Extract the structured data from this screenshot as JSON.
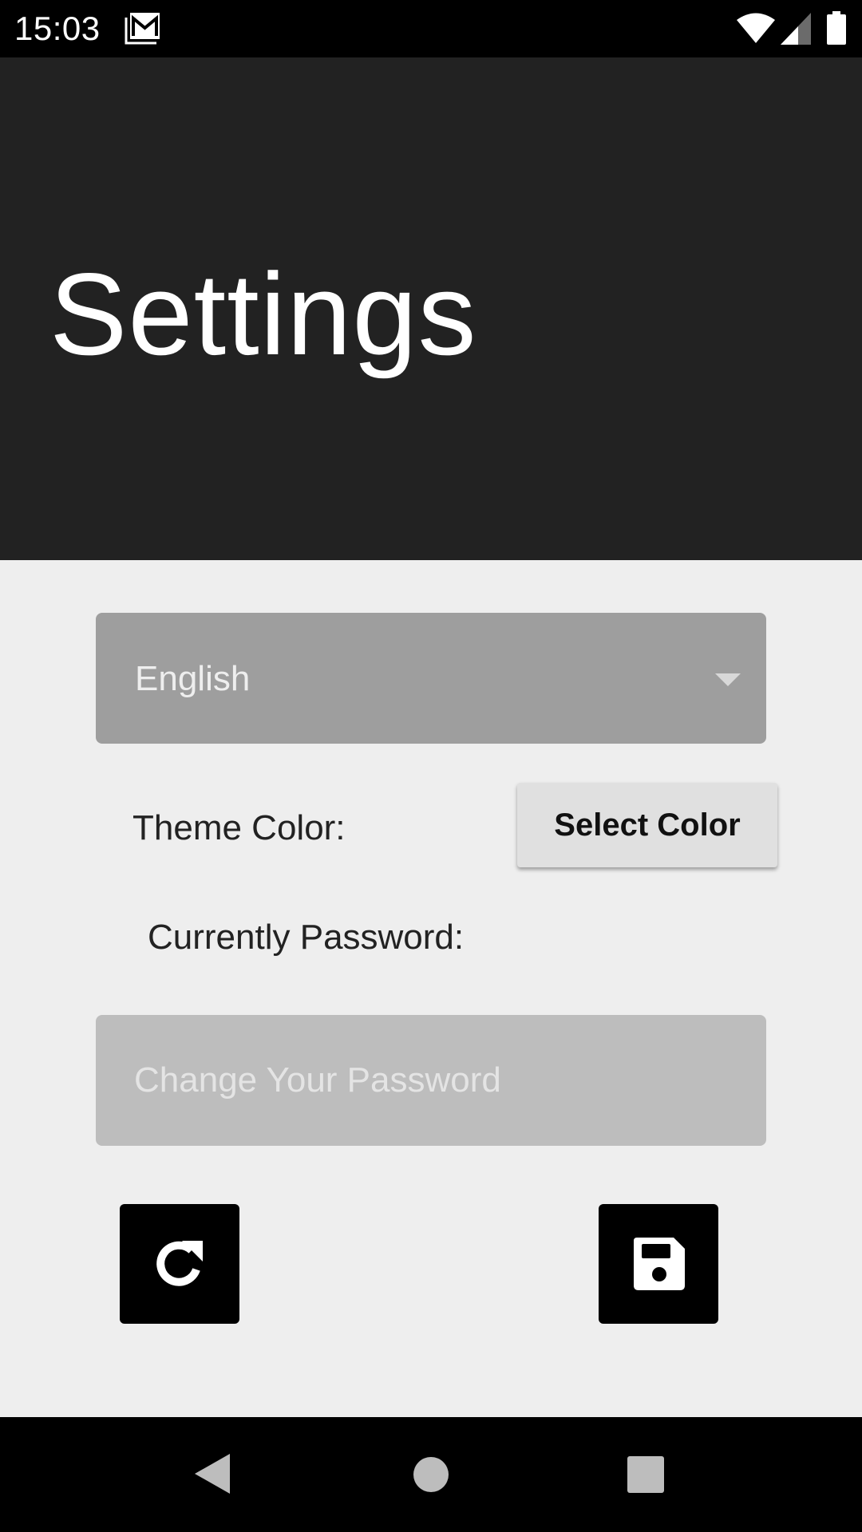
{
  "status_bar": {
    "time": "15:03",
    "icons": [
      "gmail-icon",
      "wifi-icon",
      "cell-signal-icon",
      "battery-icon"
    ]
  },
  "header": {
    "title": "Settings"
  },
  "form": {
    "language": {
      "selected": "English",
      "icon": "dropdown-arrow-icon"
    },
    "theme": {
      "label": "Theme Color:",
      "button_label": "Select Color"
    },
    "password": {
      "label": "Currently Password:",
      "placeholder": "Change Your Password",
      "value": ""
    },
    "actions": {
      "refresh_icon": "refresh-icon",
      "save_icon": "floppy-disk-icon"
    }
  },
  "nav_bar": {
    "icons": [
      "back-icon",
      "home-icon",
      "recents-icon"
    ]
  },
  "colors": {
    "header_bg": "#222222",
    "content_bg": "#eeeeee",
    "select_bg": "#9e9e9e",
    "input_bg": "#bdbdbd",
    "button_bg": "#e0e0e0",
    "icon_button_bg": "#000000"
  }
}
